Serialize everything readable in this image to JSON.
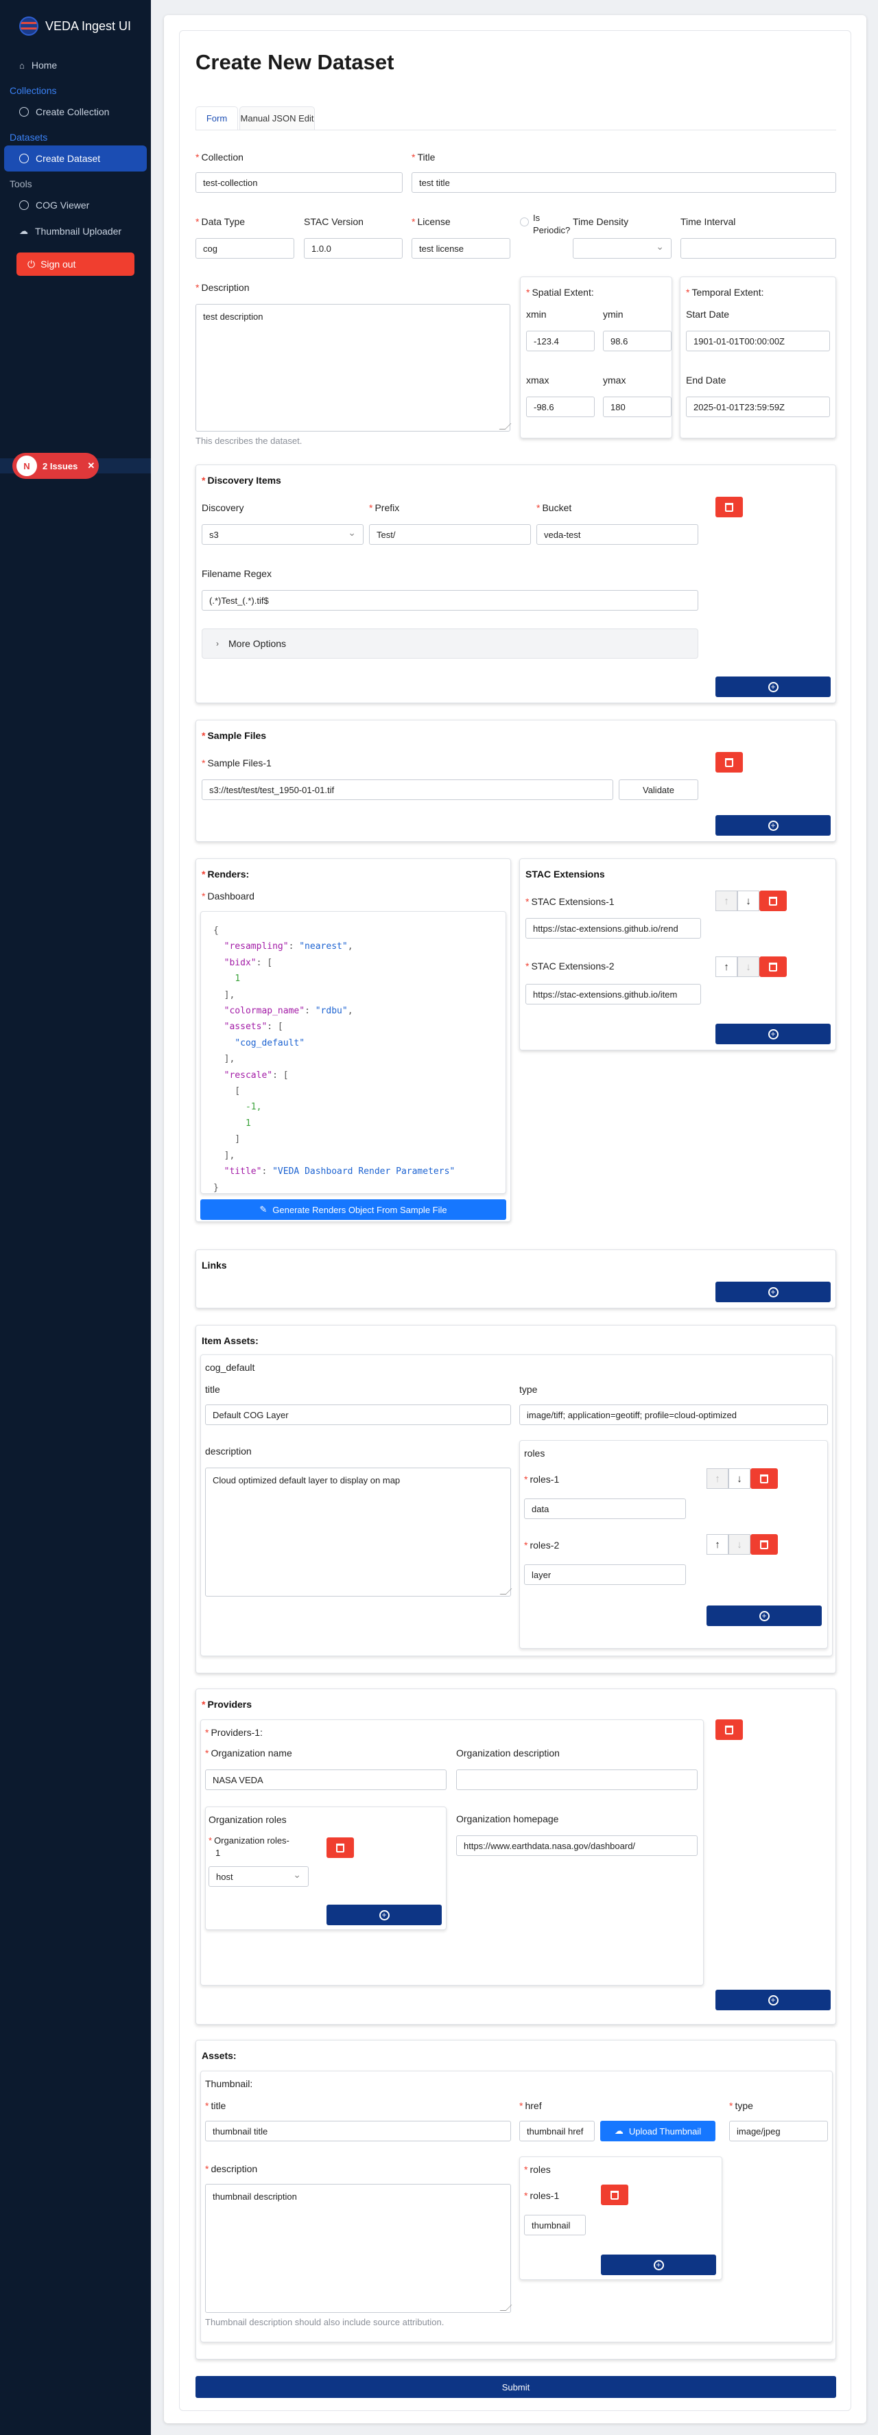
{
  "app": {
    "title": "VEDA Ingest UI"
  },
  "sidebar": {
    "home": "Home",
    "collections_group": "Collections",
    "create_collection": "Create Collection",
    "datasets_group": "Datasets",
    "create_dataset": "Create Dataset",
    "tools_group": "Tools",
    "cog_viewer": "COG Viewer",
    "thumbnail_uploader": "Thumbnail Uploader",
    "sign_out": "Sign out"
  },
  "issues": {
    "badge": "N",
    "label": "2 Issues"
  },
  "page": {
    "title": "Create New Dataset",
    "tabs": [
      "Form",
      "Manual JSON Edit"
    ]
  },
  "form": {
    "collection": {
      "label": "Collection",
      "value": "test-collection"
    },
    "title": {
      "label": "Title",
      "value": "test title"
    },
    "data_type": {
      "label": "Data Type",
      "value": "cog"
    },
    "stac_version": {
      "label": "STAC Version",
      "value": "1.0.0"
    },
    "license": {
      "label": "License",
      "value": "test license"
    },
    "is_periodic": {
      "label_1": "Is",
      "label_2": "Periodic?"
    },
    "time_density": {
      "label": "Time Density"
    },
    "time_interval": {
      "label": "Time Interval"
    },
    "description": {
      "label": "Description",
      "value": "test description",
      "help": "This describes the dataset."
    },
    "spatial": {
      "label": "Spatial Extent:",
      "xmin_label": "xmin",
      "xmin": "-123.4",
      "ymin_label": "ymin",
      "ymin": "98.6",
      "xmax_label": "xmax",
      "xmax": "-98.6",
      "ymax_label": "ymax",
      "ymax": "180"
    },
    "temporal": {
      "label": "Temporal Extent:",
      "start_label": "Start Date",
      "start": "1901-01-01T00:00:00Z",
      "end_label": "End Date",
      "end": "2025-01-01T23:59:59Z"
    }
  },
  "discovery": {
    "title": "Discovery Items",
    "discovery_label": "Discovery",
    "discovery_value": "s3",
    "prefix_label": "Prefix",
    "prefix_value": "Test/",
    "bucket_label": "Bucket",
    "bucket_value": "veda-test",
    "regex_label": "Filename Regex",
    "regex_value": "(.*)Test_(.*).tif$",
    "more_options": "More Options"
  },
  "sample_files": {
    "title": "Sample Files",
    "item_label": "Sample Files-1",
    "value": "s3://test/test/test_1950-01-01.tif",
    "validate": "Validate"
  },
  "renders": {
    "title": "Renders:",
    "dashboard_label": "Dashboard",
    "generate_button": "Generate Renders Object From Sample File",
    "json": {
      "resampling_key": "\"resampling\"",
      "resampling_val": "\"nearest\"",
      "bidx_key": "\"bidx\"",
      "bidx_val": "1",
      "colormap_key": "\"colormap_name\"",
      "colormap_val": "\"rdbu\"",
      "assets_key": "\"assets\"",
      "assets_val": "\"cog_default\"",
      "rescale_key": "\"rescale\"",
      "rescale_min": "-1,",
      "rescale_max": "1",
      "title_key": "\"title\"",
      "title_val": "\"VEDA Dashboard Render Parameters\""
    }
  },
  "stac_extensions": {
    "title": "STAC Extensions",
    "item1_label": "STAC Extensions-1",
    "item1_value": "https://stac-extensions.github.io/rend",
    "item2_label": "STAC Extensions-2",
    "item2_value": "https://stac-extensions.github.io/item"
  },
  "links": {
    "title": "Links"
  },
  "item_assets": {
    "title": "Item Assets:",
    "key": "cog_default",
    "title_label": "title",
    "title_value": "Default COG Layer",
    "type_label": "type",
    "type_value": "image/tiff; application=geotiff; profile=cloud-optimized",
    "description_label": "description",
    "description_value": "Cloud optimized default layer to display on map",
    "roles_label": "roles",
    "role1_label": "roles-1",
    "role1_value": "data",
    "role2_label": "roles-2",
    "role2_value": "layer"
  },
  "providers": {
    "title": "Providers",
    "item_label": "Providers-1:",
    "org_name_label": "Organization name",
    "org_name_value": "NASA VEDA",
    "org_desc_label": "Organization description",
    "org_roles_label": "Organization roles",
    "org_role1_label_a": "Organization roles-",
    "org_role1_label_b": "1",
    "org_role1_value": "host",
    "homepage_label": "Organization homepage",
    "homepage_value": "https://www.earthdata.nasa.gov/dashboard/"
  },
  "assets": {
    "title": "Assets:",
    "thumbnail_label": "Thumbnail:",
    "title_label": "title",
    "title_value": "thumbnail title",
    "href_label": "href",
    "href_value": "thumbnail href",
    "upload_button": "Upload Thumbnail",
    "type_label": "type",
    "type_value": "image/jpeg",
    "description_label": "description",
    "description_value": "thumbnail description",
    "description_help": "Thumbnail description should also include source attribution.",
    "roles_label": "roles",
    "role1_label": "roles-1",
    "role1_value": "thumbnail"
  },
  "submit": "Submit",
  "colors": {
    "sidebar_bg": "#0c1a2e",
    "primary": "#0d3585",
    "accent": "#1b4db3",
    "danger": "#f03e2f",
    "link_blue": "#1677ff"
  }
}
